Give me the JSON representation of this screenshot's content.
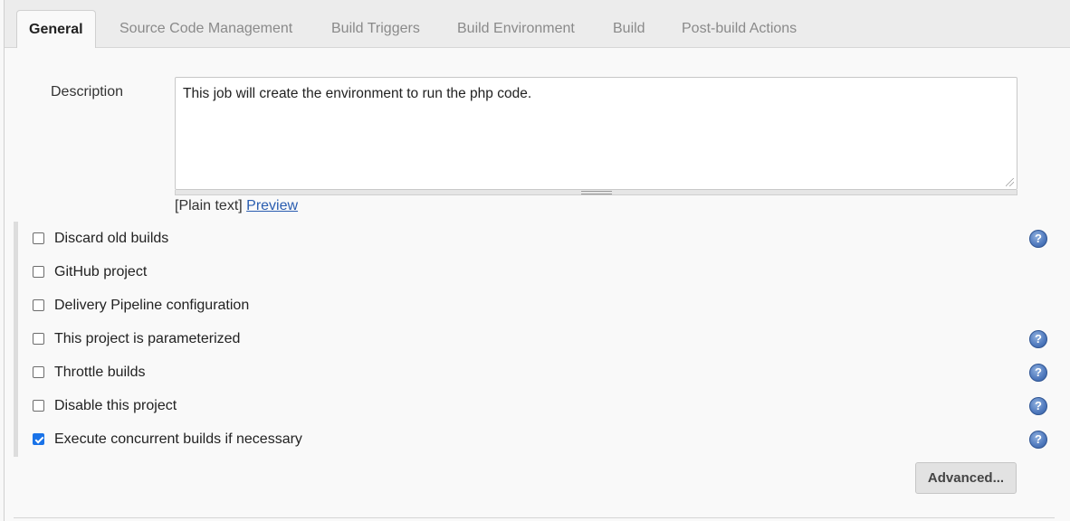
{
  "tabs": [
    {
      "label": "General"
    },
    {
      "label": "Source Code Management"
    },
    {
      "label": "Build Triggers"
    },
    {
      "label": "Build Environment"
    },
    {
      "label": "Build"
    },
    {
      "label": "Post-build Actions"
    }
  ],
  "active_tab": "General",
  "description": {
    "label": "Description",
    "value": "This job will create the environment to run the php code.",
    "format_text": "[Plain text]",
    "preview_link": "Preview"
  },
  "options": [
    {
      "label": "Discard old builds",
      "checked": false,
      "help": true
    },
    {
      "label": "GitHub project",
      "checked": false,
      "help": false
    },
    {
      "label": "Delivery Pipeline configuration",
      "checked": false,
      "help": false
    },
    {
      "label": "This project is parameterized",
      "checked": false,
      "help": true
    },
    {
      "label": "Throttle builds",
      "checked": false,
      "help": true
    },
    {
      "label": "Disable this project",
      "checked": false,
      "help": true
    },
    {
      "label": "Execute concurrent builds if necessary",
      "checked": true,
      "help": true
    }
  ],
  "help_glyph": "?",
  "advanced_button": "Advanced...",
  "colors": {
    "checkbox_checked": "#1a73e8",
    "link": "#2a5db0",
    "help_icon": "#4f79bd"
  }
}
